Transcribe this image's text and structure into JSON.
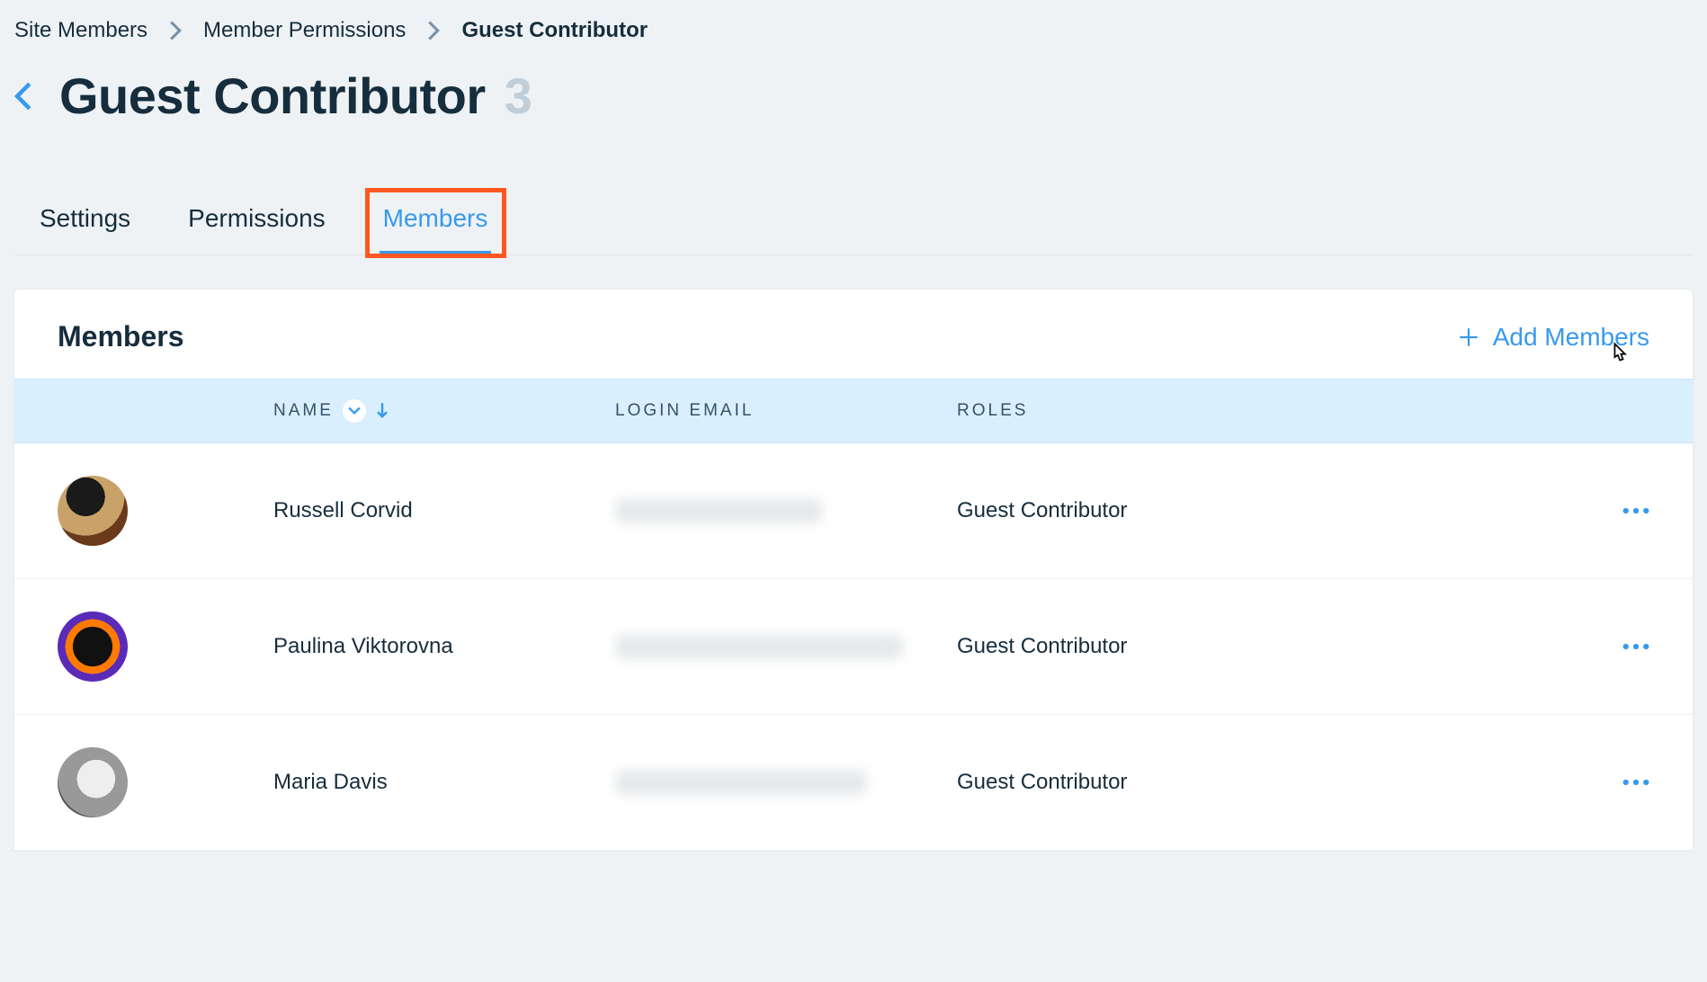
{
  "breadcrumbs": {
    "items": [
      {
        "label": "Site Members"
      },
      {
        "label": "Member Permissions"
      },
      {
        "label": "Guest Contributor"
      }
    ]
  },
  "header": {
    "title": "Guest Contributor",
    "count": "3"
  },
  "tabs": [
    {
      "label": "Settings"
    },
    {
      "label": "Permissions"
    },
    {
      "label": "Members",
      "active": true
    }
  ],
  "card": {
    "title": "Members",
    "add_label": "Add Members"
  },
  "table": {
    "columns": {
      "name": "NAME",
      "email": "LOGIN EMAIL",
      "roles": "ROLES"
    },
    "rows": [
      {
        "name": "Russell Corvid",
        "role": "Guest Contributor"
      },
      {
        "name": "Paulina Viktorovna",
        "role": "Guest Contributor"
      },
      {
        "name": "Maria Davis",
        "role": "Guest Contributor"
      }
    ]
  }
}
